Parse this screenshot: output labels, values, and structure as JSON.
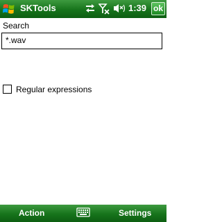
{
  "titlebar": {
    "app_title": "SKTools",
    "time": "1:39",
    "ok_label": "ok",
    "icons": [
      "windows-start-icon",
      "sync-arrows-icon",
      "signal-off-icon",
      "speaker-muted-icon"
    ]
  },
  "form": {
    "search_label": "Search",
    "search_value": "*.wav",
    "regex_label": "Regular expressions",
    "regex_checked": false
  },
  "softkeys": {
    "left_label": "Action",
    "right_label": "Settings",
    "sip_icon": "keyboard-icon"
  },
  "colors": {
    "bar_green": "#16731b",
    "ok_green": "#2ea535"
  }
}
